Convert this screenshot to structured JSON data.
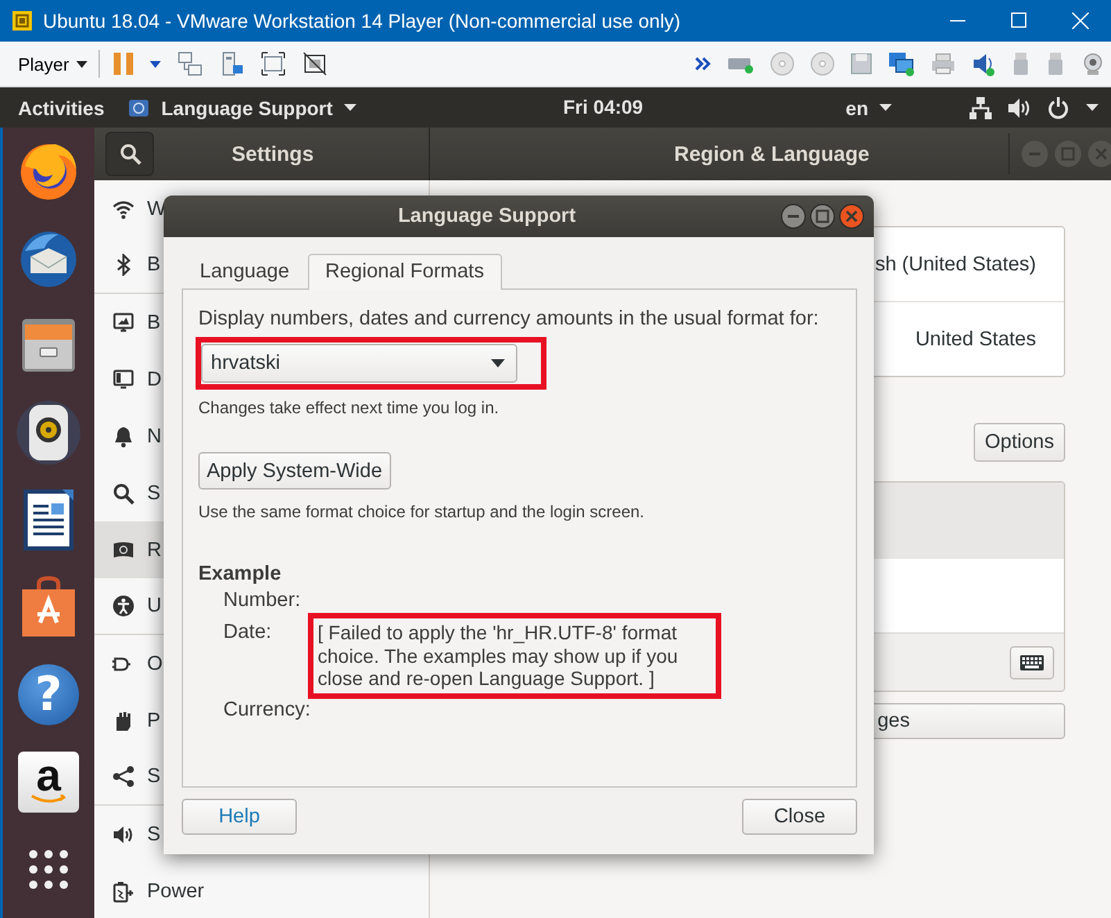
{
  "vm_window": {
    "title": "Ubuntu 18.04 - VMware Workstation 14 Player (Non-commercial use only)"
  },
  "vm_toolbar": {
    "menu": "Player"
  },
  "top_bar": {
    "activities": "Activities",
    "app_menu": "Language Support",
    "clock": "Fri 04:09",
    "input_source": "en"
  },
  "dock": {
    "help_glyph": "?",
    "store_letter": "a"
  },
  "settings": {
    "title": "Settings",
    "page_title": "Region & Language",
    "sidebar": [
      {
        "label": "W",
        "selected": false
      },
      {
        "label": "B",
        "selected": false
      },
      {
        "label": "B",
        "selected": false
      },
      {
        "label": "D",
        "selected": false
      },
      {
        "label": "N",
        "selected": false
      },
      {
        "label": "S",
        "selected": false
      },
      {
        "label": "R",
        "selected": true
      },
      {
        "label": "U",
        "selected": false
      },
      {
        "label": "O",
        "selected": false
      },
      {
        "label": "P",
        "selected": false
      },
      {
        "label": "S",
        "selected": false
      },
      {
        "label": "S",
        "selected": false
      },
      {
        "label": "Power",
        "selected": false
      }
    ],
    "language_rows": [
      "sh (United States)",
      "United States"
    ],
    "options_button": "Options",
    "manage_button": "ges"
  },
  "dialog": {
    "title": "Language Support",
    "tabs": [
      {
        "label": "Language",
        "selected": false
      },
      {
        "label": "Regional Formats",
        "selected": true
      }
    ],
    "prompt": "Display numbers, dates and currency amounts in the usual format for:",
    "format_dropdown": {
      "value": "hrvatski",
      "highlighted": true
    },
    "note": "Changes take effect next time you log in.",
    "apply_button": "Apply System-Wide",
    "apply_note": "Use the same format choice for startup and the login screen.",
    "example": {
      "heading": "Example",
      "rows": [
        {
          "label": "Number:"
        },
        {
          "label": "Date:",
          "value": "[ Failed to apply the 'hr_HR.UTF-8' format choice. The examples may show up if you close and re-open Language Support. ]",
          "highlighted": true
        },
        {
          "label": "Currency:"
        }
      ]
    },
    "help_button": "Help",
    "close_button": "Close"
  }
}
